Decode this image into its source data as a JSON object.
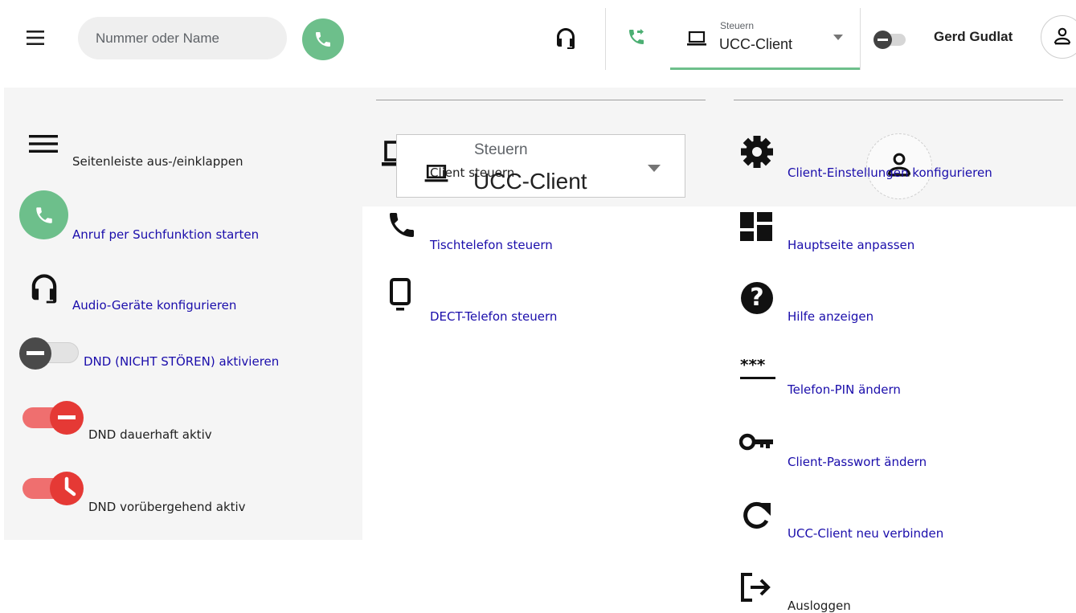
{
  "topbar": {
    "search_placeholder": "Nummer oder Name",
    "control_caption": "Steuern",
    "control_value": "UCC-Client",
    "user_name": "Gerd Gudlat"
  },
  "legend": {
    "sidebar_toggle": "Seitenleiste aus-/einklappen",
    "call_search": "Anruf per Suchfunktion starten",
    "audio_devices": "Audio-Geräte konfigurieren",
    "dnd_activate": "DND (NICHT STÖREN) aktivieren",
    "dnd_permanent": "DND dauerhaft aktiv",
    "dnd_temporary": "DND vorübergehend aktiv",
    "control_caption": "Steuern",
    "control_value": "UCC-Client",
    "client_control": "Client steuern",
    "desk_phone": "Tischtelefon steuern",
    "dect_phone": "DECT-Telefon steuern",
    "client_settings": "Client-Einstellungen konfigurieren",
    "customize_home": "Hauptseite anpassen",
    "show_help": "Hilfe anzeigen",
    "change_pin": "Telefon-PIN ändern",
    "change_password": "Client-Passwort ändern",
    "reconnect": "UCC-Client neu verbinden",
    "logout": "Ausloggen"
  },
  "colors": {
    "call_green": "#6dbf8b",
    "active_underline": "#6dbf8b",
    "link": "#1a0dab",
    "dnd_red": "#e53935",
    "dnd_track_red": "#ef6f6f",
    "panel_bg": "#f5f5f5"
  },
  "icons": [
    "menu-icon",
    "phone-icon",
    "headset-icon",
    "call-transfer-icon",
    "laptop-icon",
    "chevron-down-icon",
    "dnd-toggle-icon",
    "person-icon",
    "settings-icon",
    "dashboard-icon",
    "help-icon",
    "pin-icon",
    "key-icon",
    "refresh-icon",
    "logout-icon",
    "desk-phone-icon",
    "dect-phone-icon",
    "clock-icon"
  ]
}
